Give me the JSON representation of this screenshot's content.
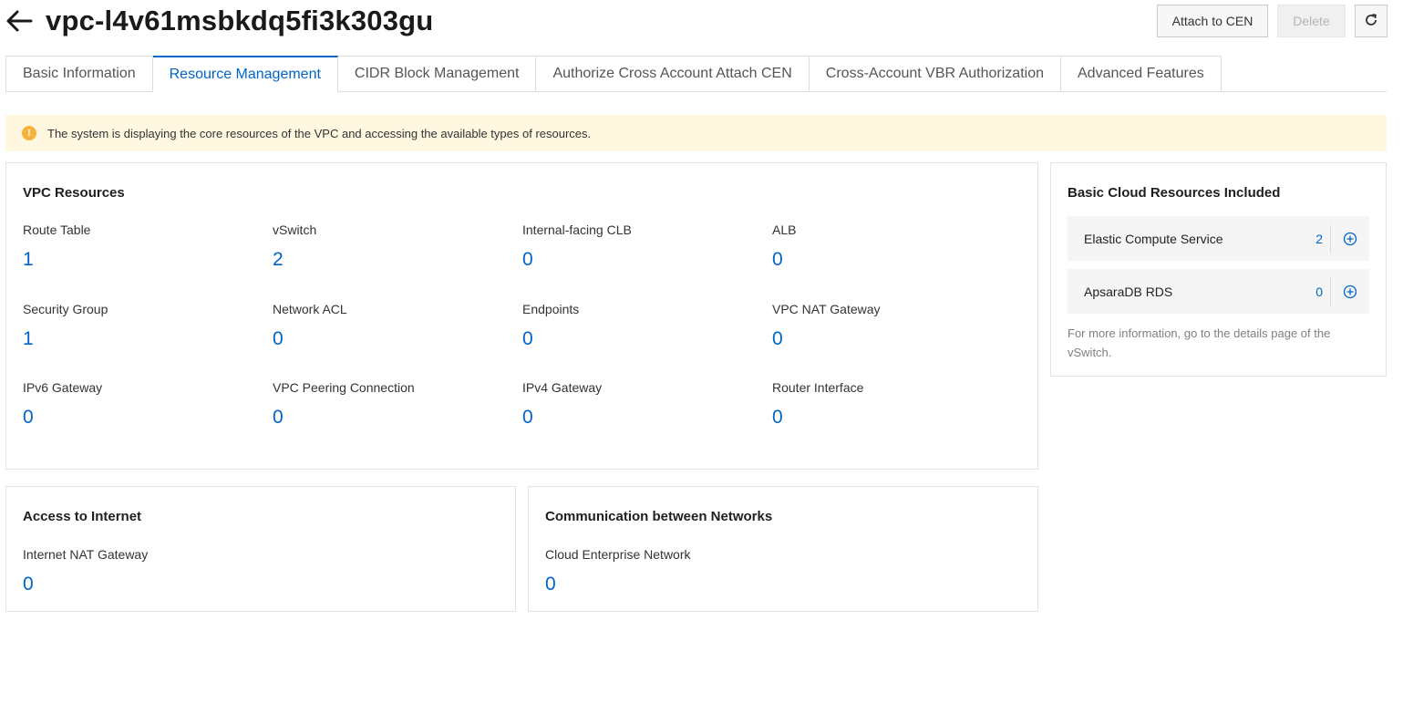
{
  "header": {
    "title": "vpc-l4v61msbkdq5fi3k303gu",
    "attach_label": "Attach to CEN",
    "delete_label": "Delete"
  },
  "tabs": [
    {
      "label": "Basic Information",
      "active": false
    },
    {
      "label": "Resource Management",
      "active": true
    },
    {
      "label": "CIDR Block Management",
      "active": false
    },
    {
      "label": "Authorize Cross Account Attach CEN",
      "active": false
    },
    {
      "label": "Cross-Account VBR Authorization",
      "active": false
    },
    {
      "label": "Advanced Features",
      "active": false
    }
  ],
  "notice": {
    "text": "The system is displaying the core resources of the VPC and accessing the available types of resources."
  },
  "vpc_resources": {
    "title": "VPC Resources",
    "items": [
      {
        "label": "Route Table",
        "value": "1"
      },
      {
        "label": "vSwitch",
        "value": "2"
      },
      {
        "label": "Internal-facing CLB",
        "value": "0"
      },
      {
        "label": "ALB",
        "value": "0"
      },
      {
        "label": "Security Group",
        "value": "1"
      },
      {
        "label": "Network ACL",
        "value": "0"
      },
      {
        "label": "Endpoints",
        "value": "0"
      },
      {
        "label": "VPC NAT Gateway",
        "value": "0"
      },
      {
        "label": "IPv6 Gateway",
        "value": "0"
      },
      {
        "label": "VPC Peering Connection",
        "value": "0"
      },
      {
        "label": "IPv4 Gateway",
        "value": "0"
      },
      {
        "label": "Router Interface",
        "value": "0"
      }
    ]
  },
  "cloud_resources": {
    "title": "Basic Cloud Resources Included",
    "items": [
      {
        "name": "Elastic Compute Service",
        "count": "2"
      },
      {
        "name": "ApsaraDB RDS",
        "count": "0"
      }
    ],
    "note": "For more information, go to the details page of the vSwitch."
  },
  "internet_access": {
    "title": "Access to Internet",
    "items": [
      {
        "label": "Internet NAT Gateway",
        "value": "0"
      }
    ]
  },
  "network_comm": {
    "title": "Communication between Networks",
    "items": [
      {
        "label": "Cloud Enterprise Network",
        "value": "0"
      }
    ]
  },
  "colors": {
    "accent": "#0064c8",
    "notice_bg": "#fff7e0",
    "warning": "#f6b23a"
  },
  "icons": {
    "back": "arrow-left-icon",
    "refresh": "refresh-icon",
    "warning": "warning-icon",
    "add": "plus-circle-icon"
  }
}
